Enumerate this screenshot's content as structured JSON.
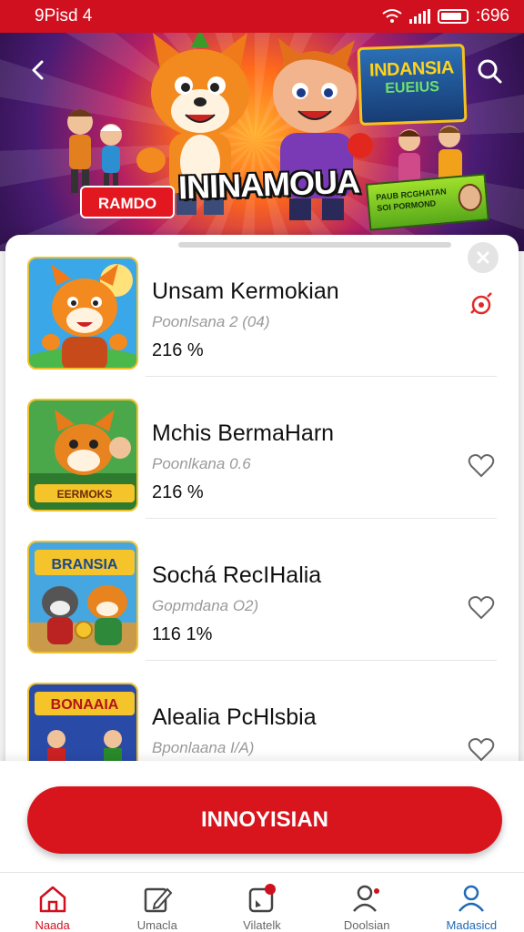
{
  "status_bar": {
    "time": "9Pisd 4",
    "battery": ":696"
  },
  "banner": {
    "tag_button": "RAMDO",
    "title": "ININAMOUA",
    "poster_line1": "INDANSIA",
    "poster_line2": "EUEIUS",
    "promo_text": "PAUB RCGHATAN SOI PORMOND"
  },
  "items": [
    {
      "title": "Unsam Kermokian",
      "subtitle": "Poonlsana 2 (04)",
      "value": "216 %",
      "liked": true,
      "thumb_label": ""
    },
    {
      "title": "Mchis BermaHarn",
      "subtitle": "Poonlkana 0.6",
      "value": "216 %",
      "liked": false,
      "thumb_label": "EERMOKS"
    },
    {
      "title": "Sochá RecIHalia",
      "subtitle": "Gopmdana O2)",
      "value": "116 1%",
      "liked": false,
      "thumb_label": "BRANSIA"
    },
    {
      "title": "Alealia PcHlsbia",
      "subtitle": "Bponlaana I/A)",
      "value": "",
      "liked": false,
      "thumb_label": "BONAAIA"
    }
  ],
  "cta": {
    "label": "INNOYISIAN"
  },
  "nav": [
    {
      "label": "Naada",
      "icon": "home-icon"
    },
    {
      "label": "Umacla",
      "icon": "edit-icon"
    },
    {
      "label": "Vilatelk",
      "icon": "notification-icon"
    },
    {
      "label": "Doolsian",
      "icon": "person-add-icon"
    },
    {
      "label": "Madasicd",
      "icon": "profile-icon"
    }
  ],
  "colors": {
    "brand_red": "#d0101e",
    "active_blue": "#2069b5"
  }
}
